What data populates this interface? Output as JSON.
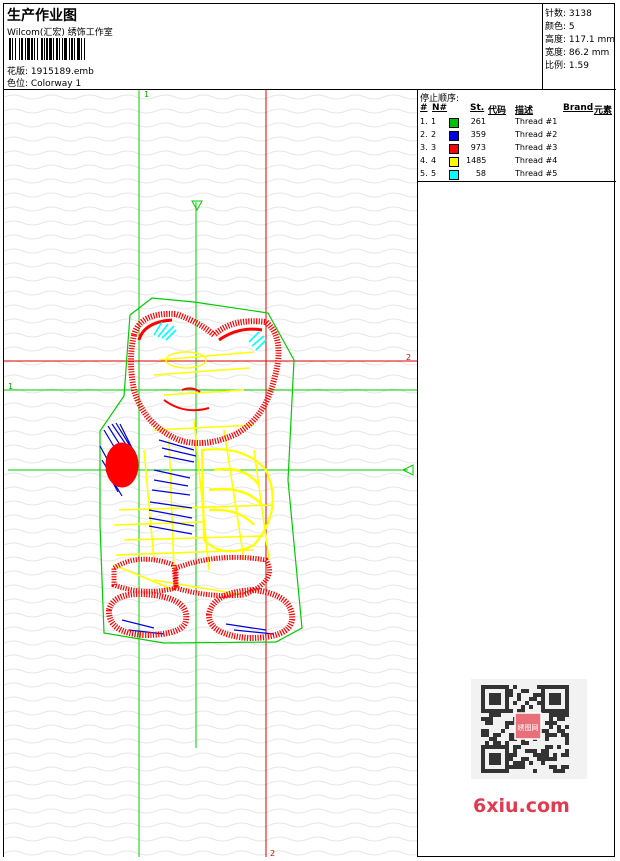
{
  "header": {
    "title": "生产作业图",
    "subtitle": "Wilcom(汇宏) 绣饰工作室",
    "pattern_label": "花版: 1915189.emb",
    "colorway_label": "色位: Colorway 1"
  },
  "stats": [
    {
      "text": "针数: 3138"
    },
    {
      "text": "颜色: 5"
    },
    {
      "text": "高度: 117.1 mm"
    },
    {
      "text": "宽度: 86.2 mm"
    },
    {
      "text": "比例: 1.59"
    }
  ],
  "stop_sequence": {
    "title": "停止顺序:",
    "headers": {
      "num": "#",
      "n": "N#",
      "st": "St.",
      "code": "代码",
      "desc": "描述",
      "brand": "Brand",
      "elem": "元素"
    },
    "rows": [
      {
        "num": "1.",
        "n": "1",
        "color": "#00c000",
        "st": "261",
        "desc": "Thread #1"
      },
      {
        "num": "2.",
        "n": "2",
        "color": "#0000e0",
        "st": "359",
        "desc": "Thread #2"
      },
      {
        "num": "3.",
        "n": "3",
        "color": "#ff0000",
        "st": "973",
        "desc": "Thread #3"
      },
      {
        "num": "4.",
        "n": "4",
        "color": "#ffff00",
        "st": "1485",
        "desc": "Thread #4"
      },
      {
        "num": "5.",
        "n": "5",
        "color": "#00ffff",
        "st": "58",
        "desc": "Thread #5"
      }
    ]
  },
  "guides": {
    "top_label": "1",
    "left_label": "1",
    "right_label": "2",
    "bottom_label": "2"
  },
  "watermark": {
    "stamp_text": "绣图网",
    "site": "6xiu.com"
  },
  "colors": {
    "green": "#00c000",
    "blue": "#0000e0",
    "red": "#ff0000",
    "yellow": "#ffff00",
    "cyan": "#00ffff",
    "guide_green": "#00cc00",
    "guide_red": "#dd0000"
  }
}
